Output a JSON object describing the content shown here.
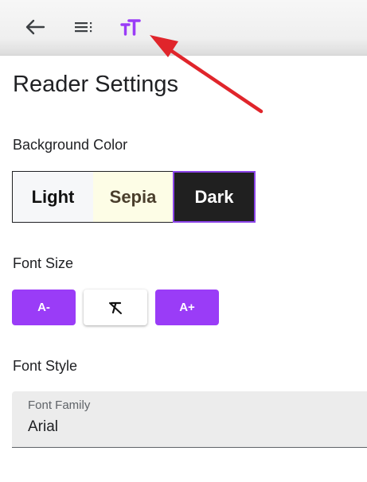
{
  "toolbar": {
    "back_icon": "arrow-left-icon",
    "toc_icon": "table-of-contents-icon",
    "font_settings_icon": "text-size-icon",
    "accent_color": "#9a3cf7"
  },
  "annotation": {
    "arrow_color": "#e0252b"
  },
  "page": {
    "title": "Reader Settings"
  },
  "background_color": {
    "label": "Background Color",
    "options": [
      {
        "label": "Light",
        "color": "#f6f7f9",
        "selected": false
      },
      {
        "label": "Sepia",
        "color": "#fdfde6",
        "selected": false
      },
      {
        "label": "Dark",
        "color": "#202020",
        "selected": true
      }
    ]
  },
  "font_size": {
    "label": "Font Size",
    "decrease_label": "A-",
    "reset_icon": "clear-format-icon",
    "increase_label": "A+"
  },
  "font_style": {
    "label": "Font Style",
    "field_label": "Font Family",
    "value": "Arial"
  }
}
